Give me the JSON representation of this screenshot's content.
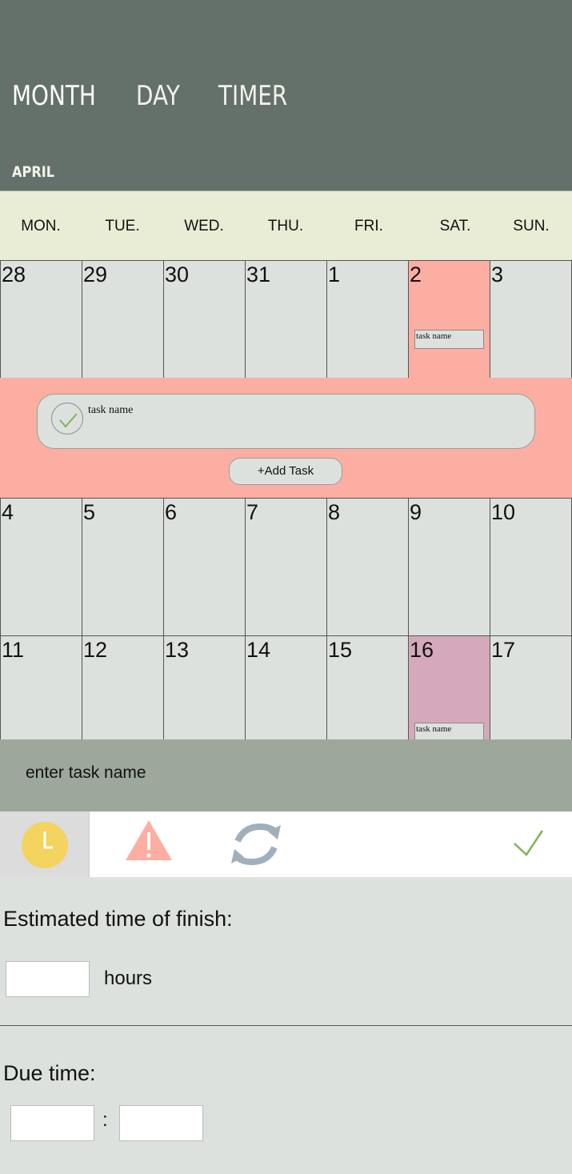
{
  "nav": {
    "tabs": [
      {
        "label": "MONTH"
      },
      {
        "label": "DAY"
      },
      {
        "label": "TIMER"
      }
    ],
    "month": "APRIL"
  },
  "weekdays": [
    "MON.",
    "TUE.",
    "WED.",
    "THU.",
    "FRI.",
    "SAT.",
    "SUN."
  ],
  "calendar": {
    "week1": [
      "28",
      "29",
      "30",
      "31",
      "1",
      "2",
      "3"
    ],
    "week2": [
      "4",
      "5",
      "6",
      "7",
      "8",
      "9",
      "10"
    ],
    "week3": [
      "11",
      "12",
      "13",
      "14",
      "15",
      "16",
      "17"
    ],
    "chip_label": "task name"
  },
  "expanded_day": {
    "task_label": "task name",
    "add_button": "+Add  Task"
  },
  "task_editor": {
    "name_placeholder": "enter  task name",
    "toolbar_icons": [
      "clock-icon",
      "warning-icon",
      "repeat-icon",
      "confirm-check-icon"
    ],
    "estimate": {
      "title": "Estimated time of finish:",
      "unit": "hours"
    },
    "due": {
      "title": "Due time:",
      "separator": ":"
    }
  },
  "colors": {
    "header": "#64716b",
    "weekday_row": "#e9edd6",
    "cell": "#dce1dd",
    "selected_day": "#fdaea2",
    "marked_day": "#d5a9bb",
    "name_bar": "#9da79b",
    "clock": "#f4d35e",
    "warning": "#fdaea2",
    "repeat": "#9fb0bc",
    "check": "#7fb25a"
  }
}
